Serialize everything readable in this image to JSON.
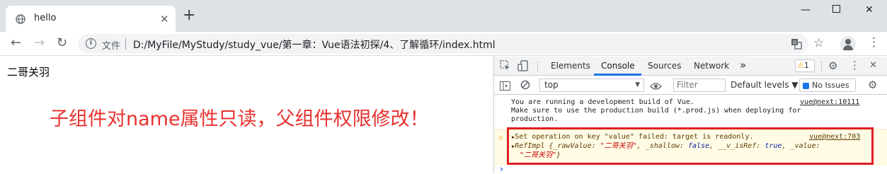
{
  "browser": {
    "tab_title": "hello",
    "new_tab": "+",
    "address": {
      "file_label": "文件",
      "url": "D:/MyFile/MyStudy/study_vue/第一章：Vue语法初探/4、了解循环/index.html"
    }
  },
  "page": {
    "name_text": "二哥关羽",
    "annotation": "子组件对name属性只读，父组件权限修改！"
  },
  "devtools": {
    "tabs": [
      "Elements",
      "Console",
      "Sources",
      "Network"
    ],
    "more_tabs": "»",
    "warning_count": "1",
    "context": "top",
    "filter_placeholder": "Filter",
    "levels": "Default levels ▼",
    "issues": "No Issues",
    "messages": {
      "info_text": "You are running a development build of Vue.\nMake sure to use the production build (*.prod.js) when deploying for\nproduction.",
      "info_source": "vue@next:10111",
      "warn_line1": "Set operation on key \"value\" failed: target is readonly.",
      "warn_source": "vue@next:703",
      "obj_prefix": "RefImpl {",
      "obj_k1": "_rawValue: ",
      "obj_v1": "\"二哥关羽\"",
      "obj_k2": ", _shallow: ",
      "obj_v2": "false",
      "obj_k3": ", __v_isRef: ",
      "obj_v3": "true",
      "obj_k4": ", _value:",
      "obj_v4": "\"二哥关羽\"",
      "obj_end": "}"
    },
    "prompt": "›"
  },
  "colors": {
    "annotation": "#e8322f",
    "highlight_box": "#e01e24",
    "warning_bg": "#fffbe5"
  },
  "icons": [
    "globe-icon",
    "close-icon",
    "back-icon",
    "forward-icon",
    "reload-icon",
    "info-icon",
    "translate-icon",
    "star-icon",
    "avatar",
    "menu-icon",
    "inspect-icon",
    "device-icon",
    "gear-icon",
    "sidebar-icon",
    "clear-icon",
    "eye-icon",
    "warning-icon"
  ]
}
